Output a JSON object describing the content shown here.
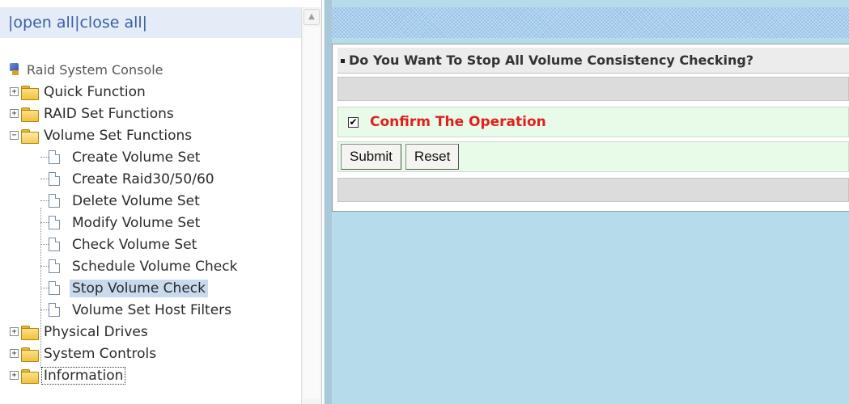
{
  "sidebar": {
    "open_all": "open all",
    "close_all": "close all",
    "separator": "|",
    "root_label": "Raid System Console",
    "items": [
      {
        "label": "Quick Function",
        "expander": "+"
      },
      {
        "label": "RAID Set Functions",
        "expander": "+"
      },
      {
        "label": "Volume Set Functions",
        "expander": "−"
      },
      {
        "label": "Physical Drives",
        "expander": "+"
      },
      {
        "label": "System Controls",
        "expander": "+"
      },
      {
        "label": "Information",
        "expander": "+"
      }
    ],
    "volume_children": [
      {
        "label": "Create Volume Set"
      },
      {
        "label": "Create Raid30/50/60"
      },
      {
        "label": "Delete Volume Set"
      },
      {
        "label": "Modify Volume Set"
      },
      {
        "label": "Check Volume Set"
      },
      {
        "label": "Schedule Volume Check"
      },
      {
        "label": "Stop Volume Check"
      },
      {
        "label": "Volume Set Host Filters"
      }
    ],
    "selected_item": "Stop Volume Check",
    "focused_item": "Information",
    "scroll_up_glyph": "▲"
  },
  "main": {
    "heading": "Do You Want To Stop All Volume Consistency Checking?",
    "confirm_label": "Confirm The Operation",
    "confirm_checked": "✔",
    "submit_label": "Submit",
    "reset_label": "Reset"
  },
  "colors": {
    "right_background": "#b6dceb",
    "confirm_text": "#e02020",
    "form_row_background": "#e8fbe8",
    "selected_highlight": "#c9d9ee"
  }
}
